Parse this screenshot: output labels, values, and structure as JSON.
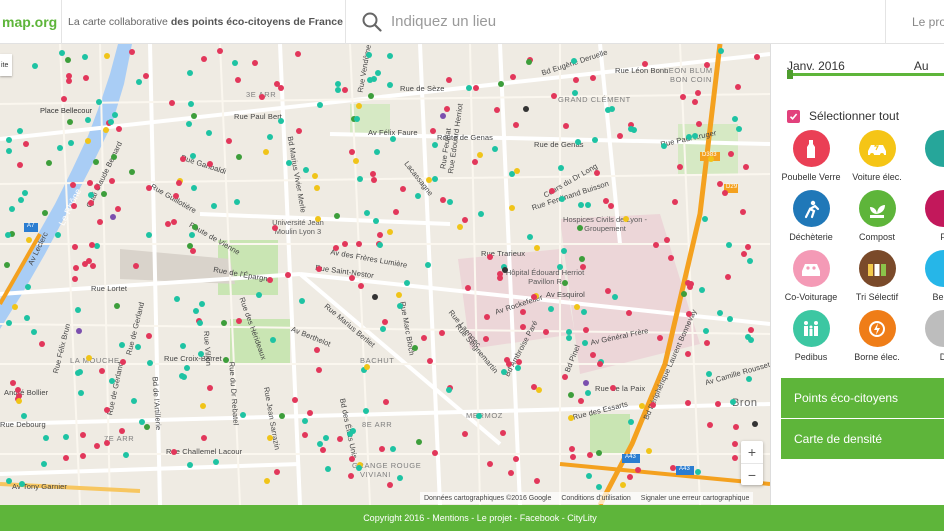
{
  "header": {
    "logo": "map.org",
    "tagline_prefix": "La carte collaborative",
    "tagline_bold": "des points éco-citoyens de France !",
    "search_placeholder": "Indiquez un lieu",
    "nav_link": "Le pro"
  },
  "map": {
    "layer_label": "ite",
    "streets": [
      "Bd Eugène Deruelle",
      "Rue Léon Bonn",
      "Rue Vendôme",
      "Rue de Sèze",
      "Rue Paul Bert",
      "Av Félix Faure",
      "Route de Genas",
      "Rue de Genas",
      "Rue Paul Kruger",
      "Cours du Dr Long",
      "Rue Ferdinand Buisson",
      "Rue Garibaldi",
      "Bd Marius Vivier Merle",
      "Lacassagne",
      "Rue Feuillat",
      "Rue Trarieux",
      "Av Esquirol",
      "Av Rockefeller",
      "Av des Frères Lumière",
      "Rue Saint-Nestor",
      "Route de Vienne",
      "Rue de l'Épargne",
      "Av Berthelot",
      "Rue Marius Berliet",
      "Rue Lortet",
      "Rue de Gerland",
      "Rue Félix Brun",
      "Rue Croix-Barret",
      "Rue Challemel Lacour",
      "Av Tony Garnier",
      "Bd de l'Artillerie",
      "Rue Debourg",
      "Rue du Dr Rebatel",
      "Av Général Frère",
      "Rue de la Paix",
      "Rue des Essarts",
      "Bd Ambroise Paré",
      "Av Camille Rousset",
      "Bd Pinel",
      "Rue Edouard Herriot",
      "Rue de Gerland",
      "Le Rhône",
      "Quai Claude Bernard",
      "Bd Périphérique Laurent Bonnevay",
      "André Bollier",
      "Av Leclerc",
      "Rue Guillotière",
      "Rue Marc Bloch",
      "Rue Villon",
      "Rue des Hérideaux",
      "Bd des États Unis",
      "Rue Jean Sarrazin",
      "Rue Seignemartin",
      "Rue Laennec"
    ],
    "districts": [
      "LEON BLUM",
      "BON COIN",
      "GRAND CLÉMENT",
      "3E ARR",
      "BACHUT",
      "8E ARR",
      "7E ARR",
      "LA MOUCHE",
      "MERMOZ",
      "GRANGE ROUGE",
      "VIVIANI",
      "Bron",
      "Place Bellecour"
    ],
    "pois": [
      "Université Jean Moulin Lyon 3",
      "Hospices Civils de Lyon - Groupement",
      "Hôpital Édouard Herriot Pavillon R"
    ],
    "road_badges": [
      "D383",
      "D29",
      "A7",
      "A43",
      "A43"
    ],
    "attribution": [
      "Données cartographiques ©2016 Google",
      "Conditions d'utilisation",
      "Signaler une erreur cartographique"
    ],
    "zoom_in": "+",
    "zoom_out": "−",
    "colors": {
      "red": "#e2375b",
      "teal": "#1ec3a3",
      "green": "#3d9e3b",
      "yellow": "#f0c419",
      "purple": "#7b4fae",
      "dark": "#333333"
    }
  },
  "sidebar": {
    "date_start": "Janv. 2016",
    "date_end": "Au",
    "select_all_label": "Sélectionner tout",
    "categories": [
      {
        "label": "Poubelle Verre",
        "color": "#ea3f55",
        "icon": "bottle-icon"
      },
      {
        "label": "Voiture élec.",
        "color": "#f5c516",
        "icon": "electric-car-icon"
      },
      {
        "label": "",
        "color": "#26a69a",
        "icon": "partial-icon"
      },
      {
        "label": "Déchèterie",
        "color": "#2078b8",
        "icon": "recycling-center-icon"
      },
      {
        "label": "Compost",
        "color": "#5eb53a",
        "icon": "compost-icon"
      },
      {
        "label": "F",
        "color": "#c2185b",
        "icon": "partial-icon"
      },
      {
        "label": "Co-Voiturage",
        "color": "#f49ab6",
        "icon": "carpool-icon"
      },
      {
        "label": "Tri Sélectif",
        "color": "#7a4a2a",
        "icon": "sorting-bins-icon"
      },
      {
        "label": "Benn",
        "color": "#26b6e8",
        "icon": "partial-icon"
      },
      {
        "label": "Pedibus",
        "color": "#3cc7a2",
        "icon": "pedibus-icon"
      },
      {
        "label": "Borne élec.",
        "color": "#ef7d18",
        "icon": "charging-station-icon"
      },
      {
        "label": "D",
        "color": "#bdbdbd",
        "icon": "partial-icon"
      }
    ],
    "button_points": "Points éco-citoyens",
    "button_density": "Carte de densité"
  },
  "footer": {
    "text": "Copyright 2016 - Mentions - Le projet - Facebook - CityLity"
  }
}
